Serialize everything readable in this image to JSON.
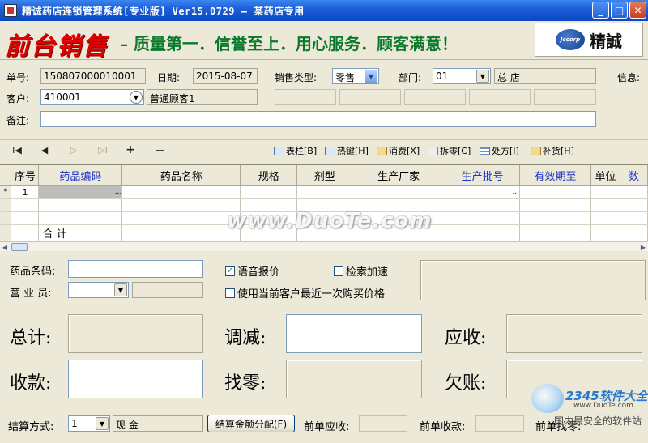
{
  "window": {
    "title": "精诚药店连锁管理系统[专业版] Ver15.0729 — 某药店专用",
    "min": "_",
    "max": "□",
    "close": "✕"
  },
  "banner": {
    "logo_text": "前台销售",
    "slogan": "– 质量第一．信誉至上．用心服务．顾客满意！",
    "brand_logo": "Jccorp",
    "brand_name": "精誠"
  },
  "form": {
    "order_no_label": "单号:",
    "order_no": "150807000010001",
    "date_label": "日期:",
    "date": "2015-08-07",
    "sale_type_label": "销售类型:",
    "sale_type": "零售",
    "dept_label": "部门:",
    "dept_code": "01",
    "dept_name": "总  店",
    "info_label": "信息:",
    "customer_label": "客户:",
    "customer_code": "410001",
    "customer_name": "普通顾客1",
    "remark_label": "备注:",
    "remark": ""
  },
  "toolbar": {
    "nav": [
      "I◀",
      "◀",
      "▷",
      "▷I",
      "+",
      "—"
    ],
    "buttons": [
      {
        "label": "表栏[B]",
        "icon": "grid-icon"
      },
      {
        "label": "热键[H]",
        "icon": "keyboard-icon"
      },
      {
        "label": "消费[X]",
        "icon": "cart-icon"
      },
      {
        "label": "拆零[C]",
        "icon": "scissor-icon"
      },
      {
        "label": "处方[I]",
        "icon": "list-icon"
      },
      {
        "label": "补货[H]",
        "icon": "restock-icon"
      }
    ]
  },
  "grid": {
    "columns": [
      {
        "label": "",
        "blue": false
      },
      {
        "label": "序号",
        "blue": false
      },
      {
        "label": "药品编码",
        "blue": true
      },
      {
        "label": "药品名称",
        "blue": false
      },
      {
        "label": "规格",
        "blue": false
      },
      {
        "label": "剂型",
        "blue": false
      },
      {
        "label": "生产厂家",
        "blue": false
      },
      {
        "label": "生产批号",
        "blue": true
      },
      {
        "label": "有效期至",
        "blue": true
      },
      {
        "label": "单位",
        "blue": false
      },
      {
        "label": "数",
        "blue": true
      }
    ],
    "row_marker": "*",
    "row_index": "1",
    "ellipsis": "...",
    "sum_label": "合  计"
  },
  "watermark": "www.DuoTe.com",
  "lower": {
    "barcode_label": "药品条码:",
    "clerk_label": "营 业 员:",
    "voice_price_label": "语音报价",
    "voice_price_checked": true,
    "search_speed_label": "检索加速",
    "last_price_label": "使用当前客户最近一次购买价格",
    "total_label": "总计:",
    "adjust_label": "调减:",
    "receivable_label": "应收:",
    "received_label": "收款:",
    "change_label": "找零:",
    "debt_label": "欠账:"
  },
  "footer": {
    "settle_label": "结算方式:",
    "settle_code": "1",
    "settle_name": "现  金",
    "alloc_button": "结算金额分配(F)",
    "prev_receivable_label": "前单应收:",
    "prev_received_label": "前单收款:",
    "prev_change_label": "前单找零:"
  },
  "corner_watermark": {
    "brand": "2345软件大全",
    "site": "www.DuoTe.com",
    "tag": "国内最安全的软件站"
  }
}
